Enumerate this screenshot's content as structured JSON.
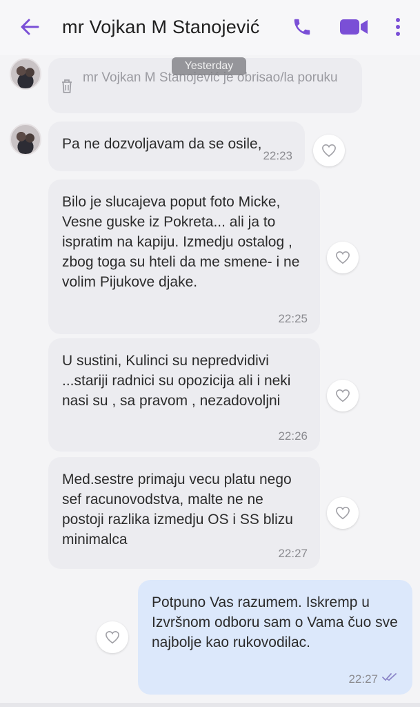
{
  "header": {
    "contact_name": "mr Vojkan M Stanojević",
    "icons": [
      "back-arrow-icon",
      "phone-icon",
      "video-camera-icon",
      "more-vertical-icon"
    ],
    "accent_color": "#7a4fd6"
  },
  "date_chip": "Yesterday",
  "deleted_message": {
    "text": "mr Vojkan M Stanojević je obrisao/la poruku",
    "icon": "trash-icon"
  },
  "messages": [
    {
      "direction": "in",
      "text": "Pa ne dozvoljavam da se osile,",
      "time": "22:23"
    },
    {
      "direction": "in",
      "text": "Bilo je slucajeva poput foto Micke, Vesne guske iz Pokreta... ali ja to ispratim na kapiju. Izmedju ostalog , zbog toga su hteli da me smene- i ne volim Pijukove djake.",
      "time": "22:25"
    },
    {
      "direction": "in",
      "text": "U sustini, Kulinci su nepredvidivi ...stariji radnici su opozicija ali i neki nasi su , sa pravom , nezadovoljni",
      "time": "22:26"
    },
    {
      "direction": "in",
      "text": "Med.sestre primaju vecu platu nego sef racunovodstva, malte ne ne postoji razlika izmedju OS i SS blizu minimalca",
      "time": "22:27"
    },
    {
      "direction": "out",
      "text": "Potpuno Vas razumem. Iskremp u Izvršnom odboru sam o Vama čuo sve najbolje kao rukovodilac.",
      "time": "22:27",
      "status": "read"
    }
  ]
}
